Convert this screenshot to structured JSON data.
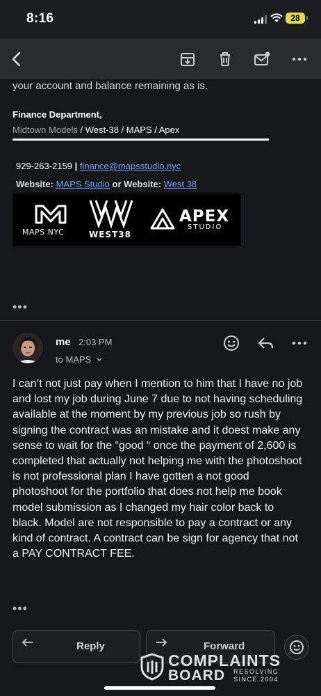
{
  "status_bar": {
    "time": "8:16",
    "battery": "28"
  },
  "toolbar": {
    "icons": [
      "back-arrow-icon",
      "archive-icon",
      "trash-icon",
      "mark-unread-icon",
      "more-icon"
    ]
  },
  "email": {
    "prev_line": "your account and balance remaining as is.",
    "signature": {
      "dept": "Finance Department,",
      "companies": [
        {
          "text": "Midtown Models",
          "grey": true
        },
        {
          "text": " / West-38 / MAPS / Apex",
          "grey": false
        }
      ],
      "phone": "929-263-2159",
      "sep": "|",
      "email": "finance@mapsstudio.nyc",
      "website_label_1": "Website:",
      "website_link_1": "MAPS Studio",
      "or": "or",
      "website_label_2": "Website:",
      "website_link_2": "West 38"
    },
    "logos": {
      "maps": "MAPS NYC",
      "west": "WEST38",
      "apex_title": "APEX",
      "apex_sub": "STUDIO"
    },
    "ellipsis": "•••"
  },
  "message": {
    "sender": "me",
    "time": "2:03 PM",
    "to": "to MAPS",
    "body": "I can’t not just pay when I mention to him that I have no job and lost my job during June 7 due to not having scheduling available at the moment by my previous job so rush by signing the contract was an mistake and it doest make any sense to wait for the “good “ once the payment of 2,600 is completed that actually not helping me with the photoshoot is not professional plan I have gotten a not good photoshoot for the portfolio that does not help me book model submission as I changed my hair color back to black. Model are not responsible to pay a contract or any kind of contract. A contract can be sign for agency that not a PAY CONTRACT FEE.",
    "ellipsis": "•••"
  },
  "actions": {
    "reply": "Reply",
    "forward": "Forward"
  },
  "watermark": {
    "line1": "COMPLAINTS",
    "line2": "BOARD",
    "tag1": "RESOLVING",
    "tag2": "SINCE 2004"
  }
}
